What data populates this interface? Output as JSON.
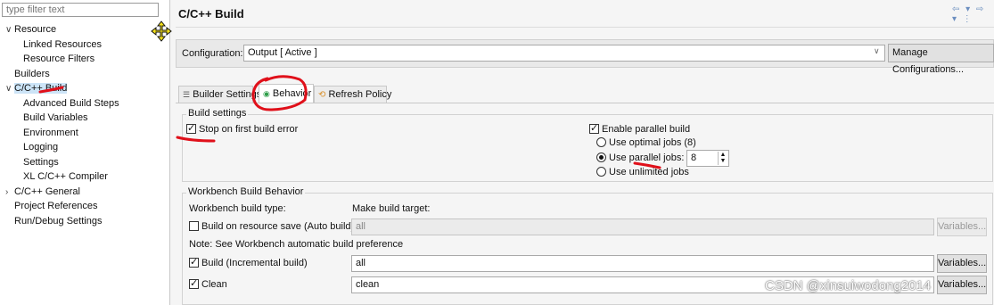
{
  "filter": {
    "placeholder": "type filter text"
  },
  "tree": [
    {
      "chev": "∨",
      "label": "Resource"
    },
    {
      "chev": "",
      "label": "Linked Resources"
    },
    {
      "chev": "",
      "label": "Resource Filters"
    },
    {
      "chev": "",
      "label": "Builders"
    },
    {
      "chev": "∨",
      "label": "C/C++ Build"
    },
    {
      "chev": "",
      "label": "Advanced Build Steps"
    },
    {
      "chev": "",
      "label": "Build Variables"
    },
    {
      "chev": "",
      "label": "Environment"
    },
    {
      "chev": "",
      "label": "Logging"
    },
    {
      "chev": "",
      "label": "Settings"
    },
    {
      "chev": "",
      "label": "XL C/C++ Compiler"
    },
    {
      "chev": "›",
      "label": "C/C++ General"
    },
    {
      "chev": "",
      "label": "Project References"
    },
    {
      "chev": "",
      "label": "Run/Debug Settings"
    }
  ],
  "header": {
    "title": "C/C++ Build",
    "nav": "⇦ ▾ ⇨ ▾ ⋮"
  },
  "configuration": {
    "label": "Configuration:",
    "value": "Output  [ Active ]",
    "manage_button": "Manage Configurations..."
  },
  "tabs": [
    {
      "icon": "☰",
      "label": "Builder Settings"
    },
    {
      "icon": "◉",
      "label": "Behavior"
    },
    {
      "icon": "⟲",
      "label": "Refresh Policy"
    }
  ],
  "build_settings": {
    "title": "Build settings",
    "stop_on_error": "Stop on first build error",
    "enable_parallel": "Enable parallel build",
    "use_optimal": "Use optimal jobs (8)",
    "use_parallel": "Use parallel jobs:",
    "parallel_jobs_value": "8",
    "use_unlimited": "Use unlimited jobs"
  },
  "workbench": {
    "title": "Workbench Build Behavior",
    "build_type_header": "Workbench build type:",
    "make_target_header": "Make build target:",
    "auto_build_label": "Build on resource save (Auto build)",
    "auto_build_value": "all",
    "auto_build_variables": "Variables...",
    "note": "Note: See Workbench automatic build preference",
    "incremental_label": "Build (Incremental build)",
    "incremental_value": "all",
    "incremental_variables": "Variables...",
    "clean_label": "Clean",
    "clean_value": "clean",
    "clean_variables": "Variables..."
  },
  "watermark": "CSDN @xinsuiwodong2014",
  "colors": {
    "annotation": "#e0101a",
    "selection": "#cce4f7",
    "behavior_icon": "#2e9e4a",
    "refresh_icon": "#d9902a"
  }
}
